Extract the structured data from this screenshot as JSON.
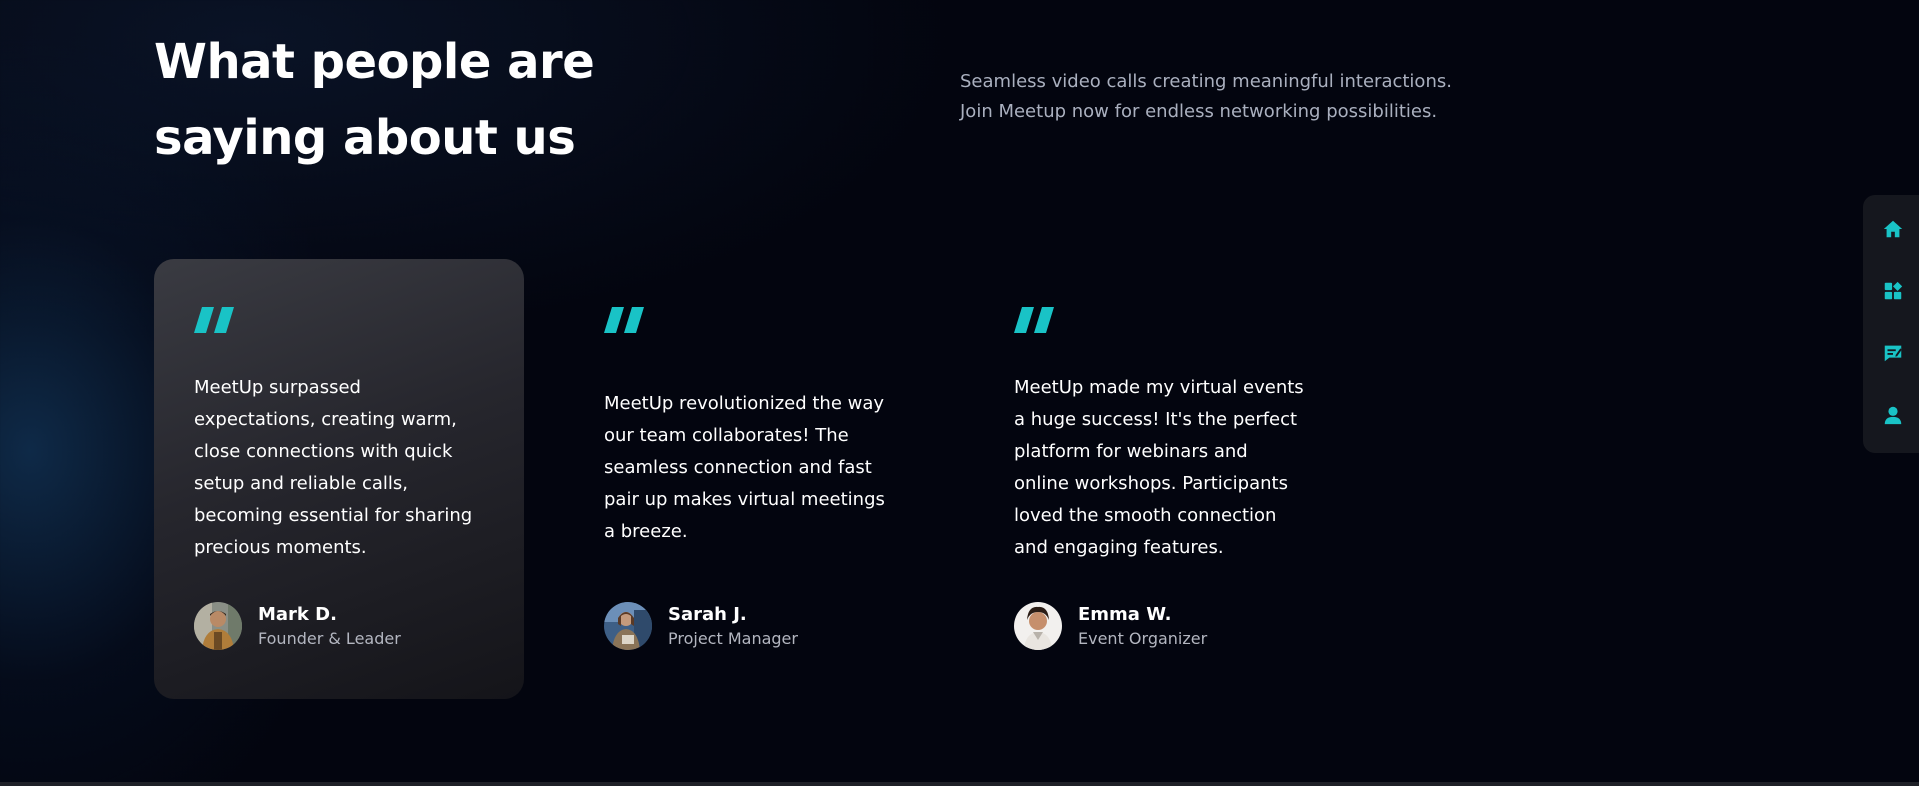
{
  "section": {
    "heading_line1": "What people are",
    "heading_line2": "saying about us",
    "subtext_line1": "Seamless video calls creating meaningful interactions.",
    "subtext_line2": "Join Meetup now for endless networking possibilities."
  },
  "colors": {
    "accent": "#19c3c6",
    "background": "#03050f",
    "card_active": "#2a2b31",
    "nav_background": "#15171e"
  },
  "testimonials": [
    {
      "quote_icon": "quote-icon",
      "lines": [
        "MeetUp surpassed",
        "expectations, creating warm,",
        "close connections with quick",
        "setup and reliable calls,",
        "becoming essential for sharing",
        "precious moments."
      ],
      "name": "Mark D.",
      "role": "Founder & Leader",
      "active": true
    },
    {
      "quote_icon": "quote-icon",
      "lines": [
        "MeetUp revolutionized the way",
        "our team collaborates! The",
        "seamless connection and fast",
        "pair up makes virtual meetings",
        "a breeze."
      ],
      "name": "Sarah J.",
      "role": "Project Manager",
      "active": false
    },
    {
      "quote_icon": "quote-icon",
      "lines": [
        "MeetUp made my virtual events",
        "a huge success! It's the perfect",
        "platform for webinars and",
        "online workshops. Participants",
        "loved the smooth connection",
        "and engaging features."
      ],
      "name": "Emma W.",
      "role": "Event Organizer",
      "active": false
    }
  ],
  "side_nav": {
    "items": [
      "home-icon",
      "dashboard-icon",
      "chat-icon",
      "user-icon"
    ]
  }
}
